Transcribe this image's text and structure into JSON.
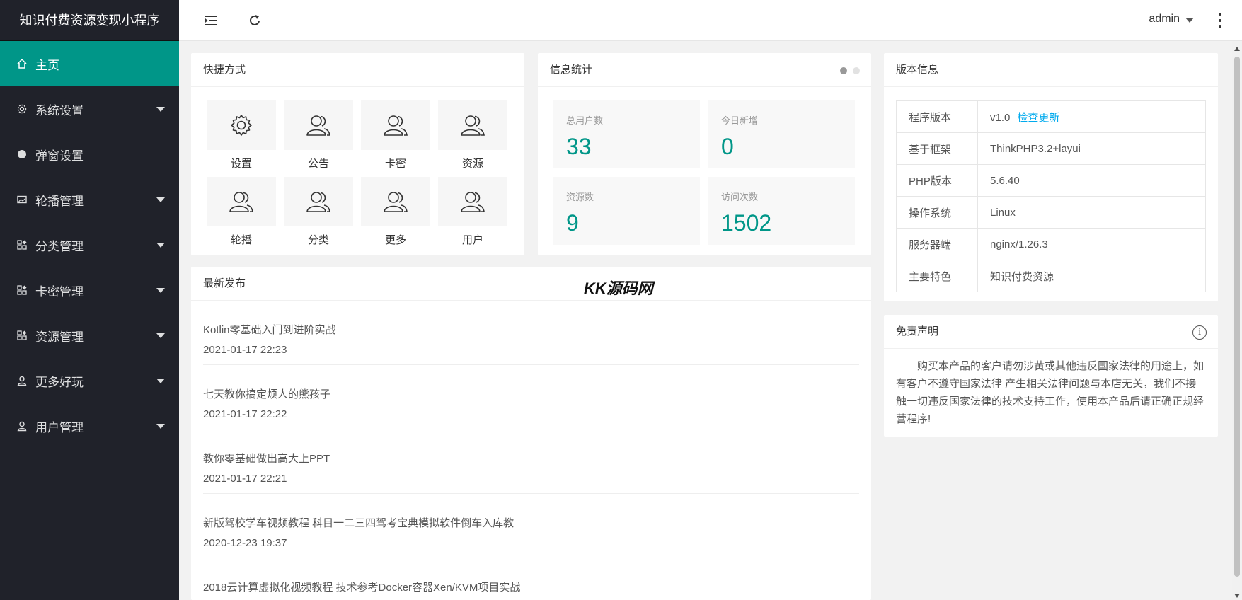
{
  "app": {
    "title": "知识付费资源变现小程序"
  },
  "colors": {
    "accent": "#009688",
    "link": "#01aaed",
    "sidebar_bg": "#20222a"
  },
  "sidebar": {
    "items": [
      {
        "label": "主页",
        "icon": "home-icon",
        "active": true,
        "has_caret": false
      },
      {
        "label": "系统设置",
        "icon": "gear-icon",
        "active": false,
        "has_caret": true
      },
      {
        "label": "弹窗设置",
        "icon": "circle-icon",
        "active": false,
        "has_caret": false
      },
      {
        "label": "轮播管理",
        "icon": "picture-icon",
        "active": false,
        "has_caret": true
      },
      {
        "label": "分类管理",
        "icon": "apps-icon",
        "active": false,
        "has_caret": true
      },
      {
        "label": "卡密管理",
        "icon": "apps-icon",
        "active": false,
        "has_caret": true
      },
      {
        "label": "资源管理",
        "icon": "apps-icon",
        "active": false,
        "has_caret": true
      },
      {
        "label": "更多好玩",
        "icon": "user-icon",
        "active": false,
        "has_caret": true
      },
      {
        "label": "用户管理",
        "icon": "user-icon",
        "active": false,
        "has_caret": true
      }
    ]
  },
  "header": {
    "user": "admin"
  },
  "shortcuts": {
    "title": "快捷方式",
    "items": [
      {
        "label": "设置",
        "icon": "gear-icon"
      },
      {
        "label": "公告",
        "icon": "users-icon"
      },
      {
        "label": "卡密",
        "icon": "users-icon"
      },
      {
        "label": "资源",
        "icon": "users-icon"
      },
      {
        "label": "轮播",
        "icon": "users-icon"
      },
      {
        "label": "分类",
        "icon": "users-icon"
      },
      {
        "label": "更多",
        "icon": "users-icon"
      },
      {
        "label": "用户",
        "icon": "users-icon"
      }
    ]
  },
  "stats": {
    "title": "信息统计",
    "items": [
      {
        "label": "总用户数",
        "value": "33"
      },
      {
        "label": "今日新增",
        "value": "0"
      },
      {
        "label": "资源数",
        "value": "9"
      },
      {
        "label": "访问次数",
        "value": "1502"
      }
    ]
  },
  "version": {
    "title": "版本信息",
    "rows": [
      {
        "key": "程序版本",
        "value": "v1.0",
        "link": "检查更新"
      },
      {
        "key": "基于框架",
        "value": "ThinkPHP3.2+layui"
      },
      {
        "key": "PHP版本",
        "value": "5.6.40"
      },
      {
        "key": "操作系统",
        "value": "Linux"
      },
      {
        "key": "服务器端",
        "value": "nginx/1.26.3"
      },
      {
        "key": "主要特色",
        "value": "知识付费资源"
      }
    ]
  },
  "disclaimer": {
    "title": "免责声明",
    "text": "购买本产品的客户请勿涉黄或其他违反国家法律的用途上，如有客户不遵守国家法律 产生相关法律问题与本店无关，我们不接触一切违反国家法律的技术支持工作，使用本产品后请正确正规经营程序!"
  },
  "latest": {
    "title": "最新发布",
    "posts": [
      {
        "title": "Kotlin零基础入门到进阶实战",
        "time": "2021-01-17 22:23"
      },
      {
        "title": "七天教你搞定烦人的熊孩子",
        "time": "2021-01-17 22:22"
      },
      {
        "title": "教你零基础做出高大上PPT",
        "time": "2021-01-17 22:21"
      },
      {
        "title": "新版驾校学车视频教程 科目一二三四驾考宝典模拟软件倒车入库教",
        "time": "2020-12-23 19:37"
      },
      {
        "title": "2018云计算虚拟化视频教程 技术参考Docker容器Xen/KVM项目实战",
        "time": ""
      }
    ]
  },
  "watermark": "KK源码网"
}
